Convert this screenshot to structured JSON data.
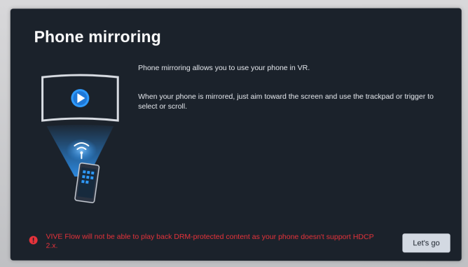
{
  "dialog": {
    "title": "Phone mirroring",
    "paragraphs": [
      "Phone mirroring allows you to use your phone in VR.",
      "When your phone is mirrored, just aim toward the screen and use the trackpad or trigger to select or scroll."
    ],
    "illustration_icon": "phone-mirroring-illustration",
    "warning": {
      "icon": "alert-circle-icon",
      "text": "VIVE Flow will not be able to play back DRM-protected content as your phone doesn't support HDCP 2.x.",
      "color": "#e8333b"
    },
    "primary_button_label": "Let's go"
  },
  "colors": {
    "panel_background": "#1b222b",
    "accent": "#2f9bff",
    "button_background": "#d3d9e2"
  }
}
